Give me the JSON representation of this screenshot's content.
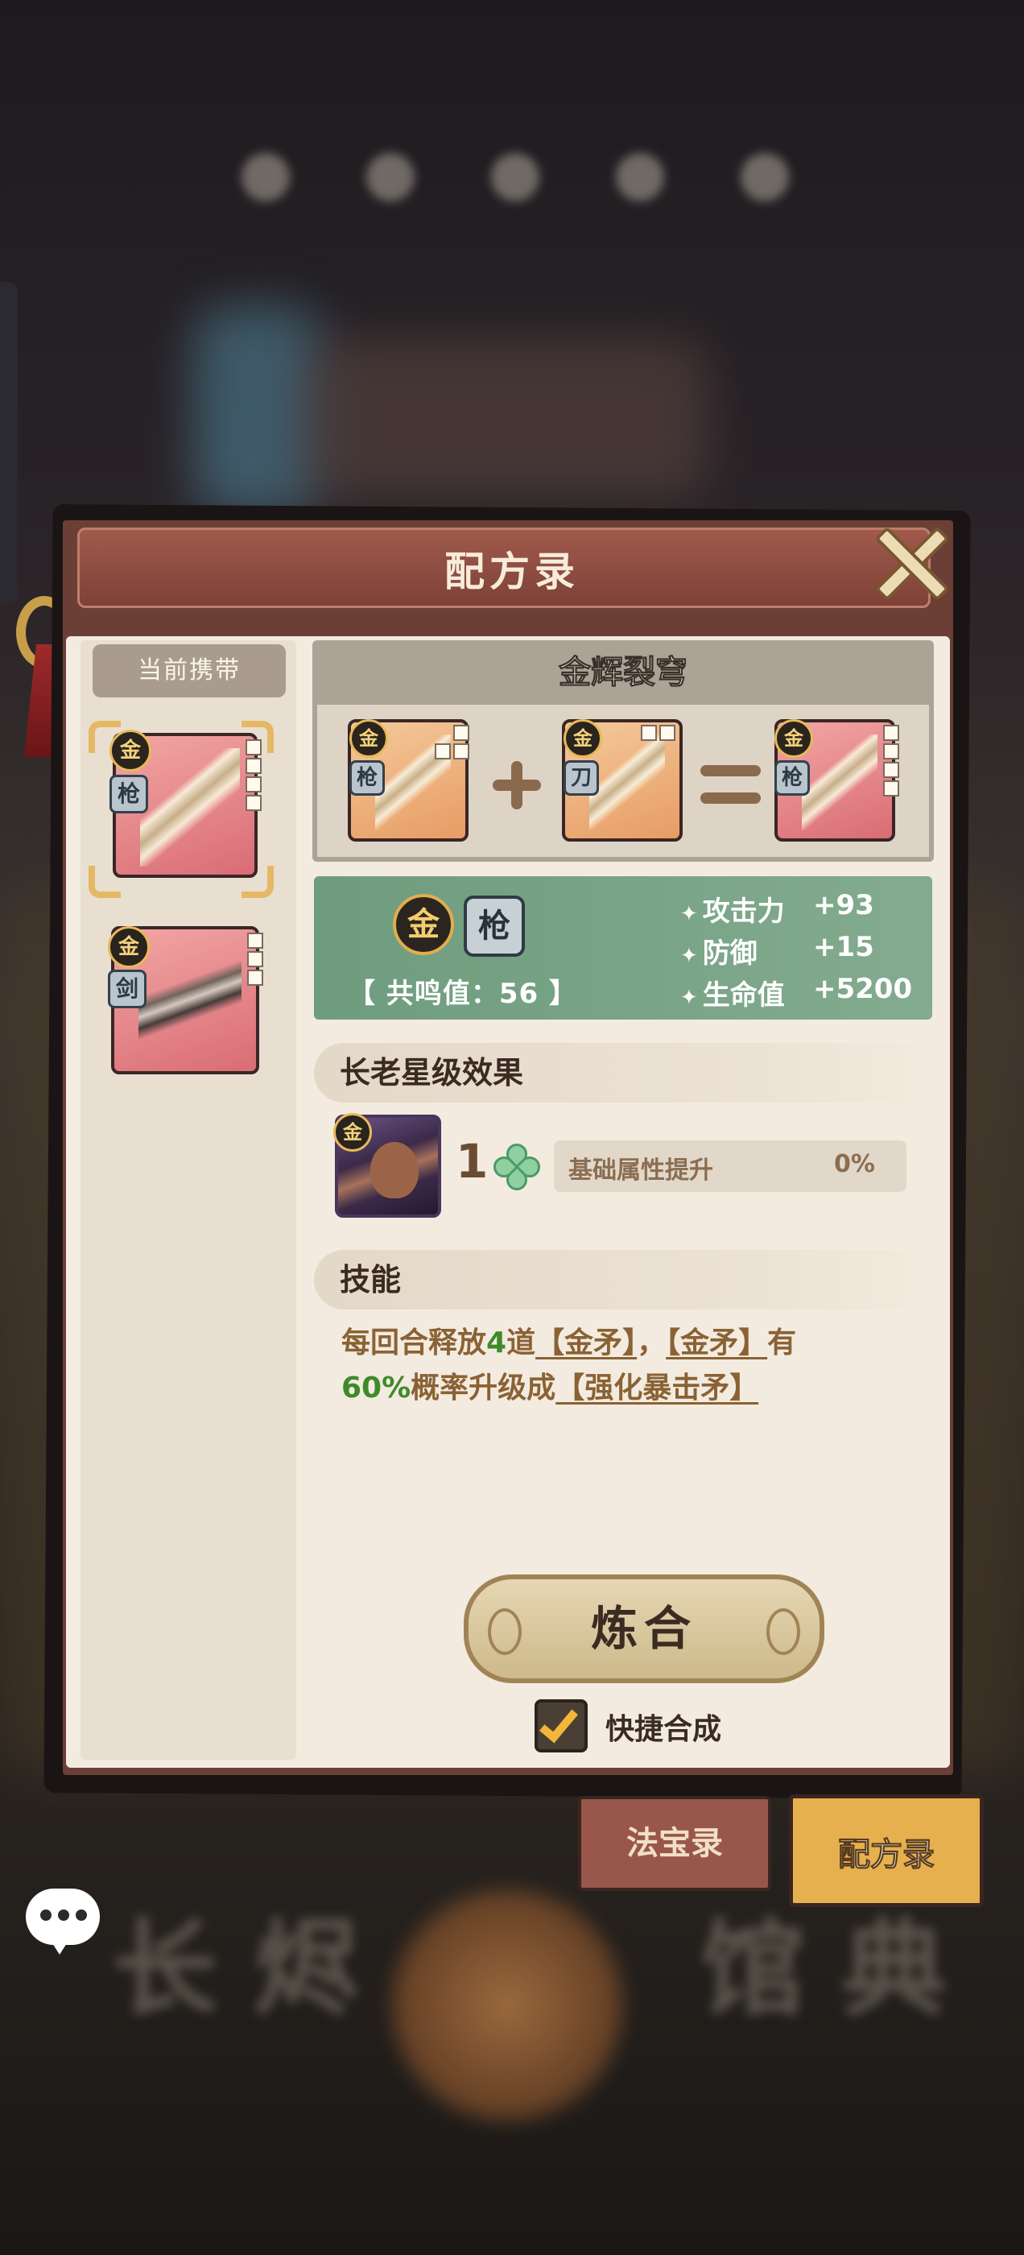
{
  "dialog": {
    "title": "配方录",
    "close_icon": "close-x-icon"
  },
  "left_panel": {
    "title": "当前携带",
    "items": [
      {
        "grade": "金",
        "type": "枪",
        "rarity_color": "#e47b84"
      },
      {
        "grade": "金",
        "type": "剑",
        "rarity_color": "#e47b84"
      }
    ]
  },
  "recipe": {
    "name": "金辉裂穹",
    "ingredients": [
      {
        "grade": "金",
        "type": "枪",
        "rarity_color": "#efb27c"
      },
      {
        "grade": "金",
        "type": "刀",
        "rarity_color": "#efb27c"
      }
    ],
    "result": {
      "grade": "金",
      "type": "枪",
      "rarity_color": "#e47b84"
    },
    "plus_icon": "plus-icon",
    "equals_icon": "equals-icon"
  },
  "attributes": {
    "grade": "金",
    "type": "枪",
    "resonance": "【 共鸣值：56 】",
    "stats": [
      {
        "name": "攻击力",
        "value": "+93"
      },
      {
        "name": "防御",
        "value": "+15"
      },
      {
        "name": "生命值",
        "value": "+5200"
      }
    ]
  },
  "elder_section": {
    "title": "长老星级效果",
    "elder_grade": "金",
    "star_level": "1",
    "effect_label": "基础属性提升",
    "effect_value": "0%"
  },
  "skill_section": {
    "title": "技能",
    "text_parts": {
      "p1": "每回合释放",
      "count": "4",
      "p2": "道",
      "link1": "【金矛】",
      "p3": "，",
      "link2": "【金矛】",
      "p4": "有",
      "chance": "60%",
      "p5": "概率升级成",
      "link3": "【强化暴击矛】"
    }
  },
  "actions": {
    "refine_label": "炼合",
    "quick_label": "快捷合成",
    "quick_checked": true
  },
  "tabs": [
    {
      "label": "法宝录",
      "active": false
    },
    {
      "label": "配方录",
      "active": true
    }
  ],
  "colors": {
    "accent_gold": "#e8b956",
    "panel_brown": "#6b3f36",
    "stats_green": "#78a387",
    "highlight_green": "#3f8a2b"
  }
}
